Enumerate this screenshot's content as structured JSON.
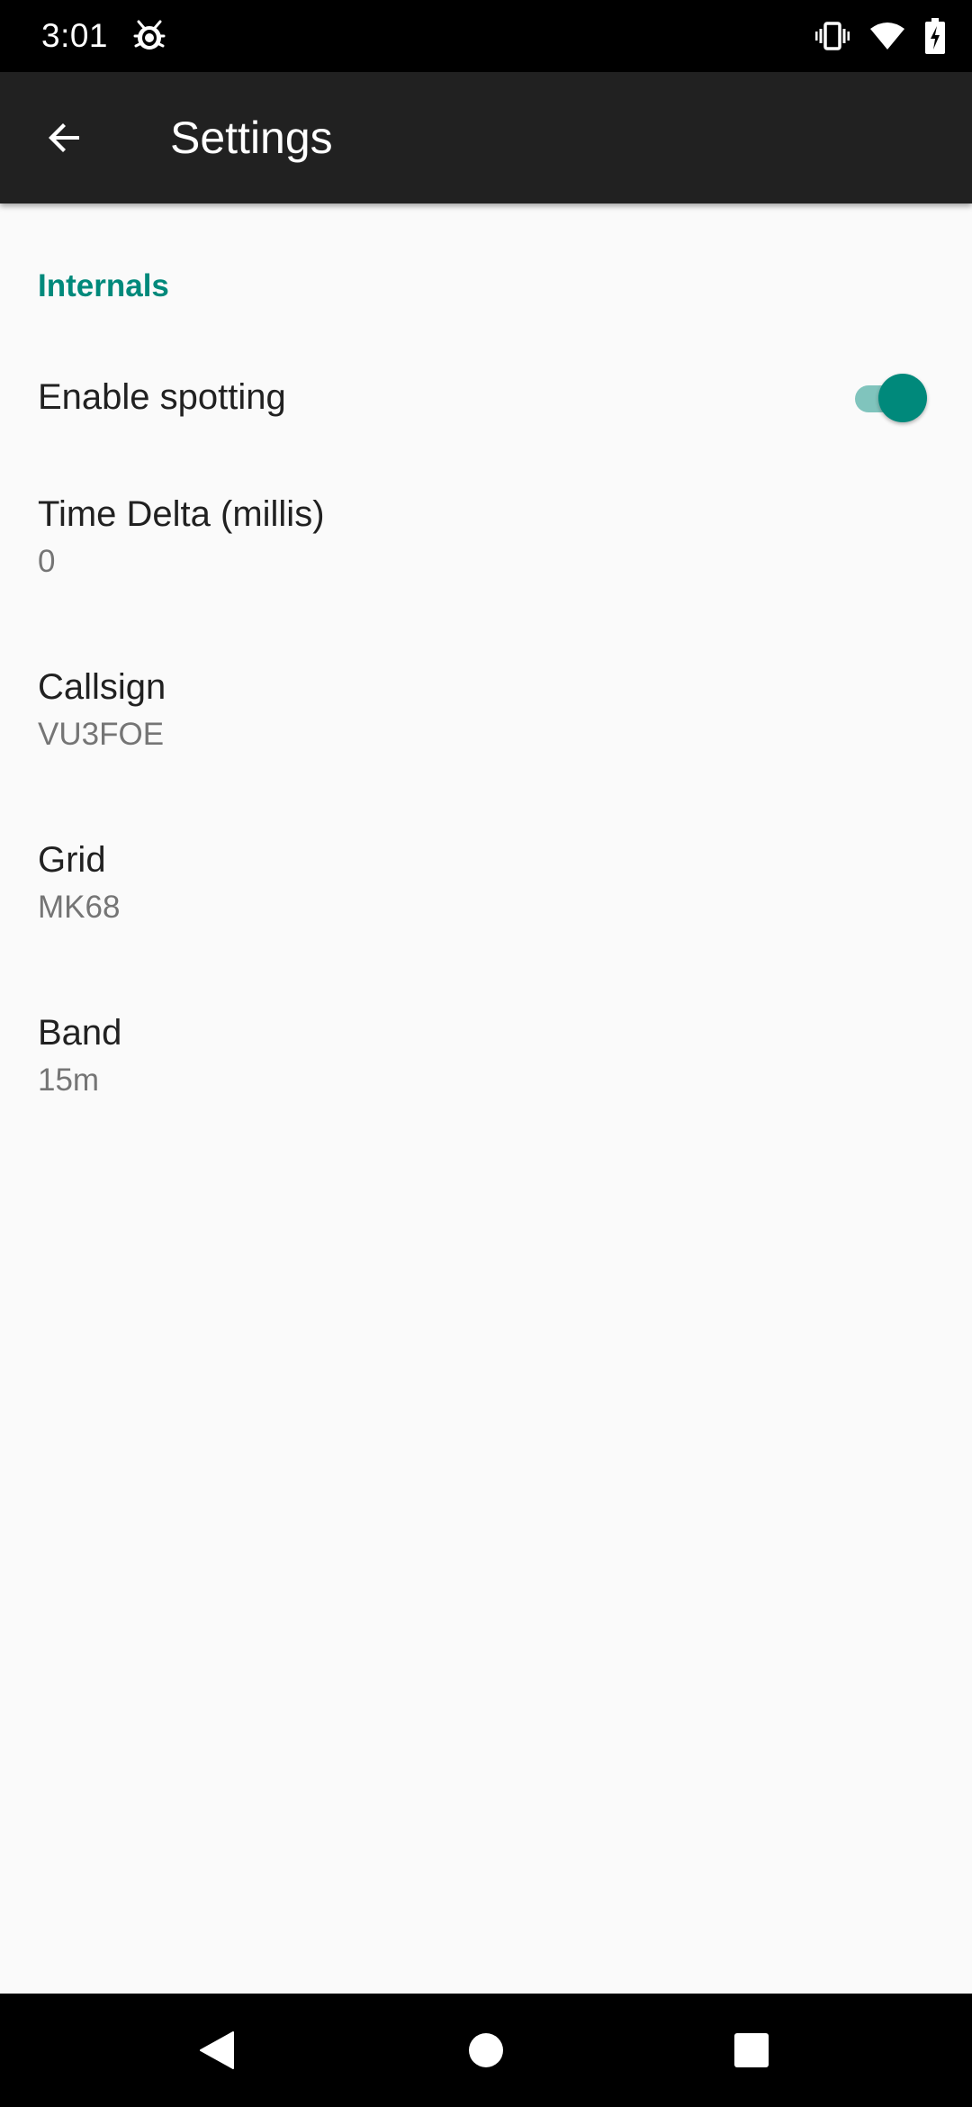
{
  "status_bar": {
    "time": "3:01",
    "left_icon": "bug-icon",
    "right_icons": [
      "vibrate-icon",
      "wifi-icon",
      "battery-charging-icon"
    ]
  },
  "app_bar": {
    "back_icon": "arrow-back-icon",
    "title": "Settings"
  },
  "colors": {
    "accent": "#00897b",
    "app_bar": "#212121",
    "background": "#fafafa",
    "switch_track": "#80c4bd"
  },
  "settings": {
    "section_header": "Internals",
    "enable_spotting": {
      "title": "Enable spotting",
      "checked": true
    },
    "time_delta": {
      "title": "Time Delta (millis)",
      "summary": "0"
    },
    "callsign": {
      "title": "Callsign",
      "summary": "VU3FOE"
    },
    "grid": {
      "title": "Grid",
      "summary": "MK68"
    },
    "band": {
      "title": "Band",
      "summary": "15m"
    }
  },
  "nav_bar": {
    "icons": [
      "back-triangle-icon",
      "home-circle-icon",
      "recents-square-icon"
    ]
  }
}
